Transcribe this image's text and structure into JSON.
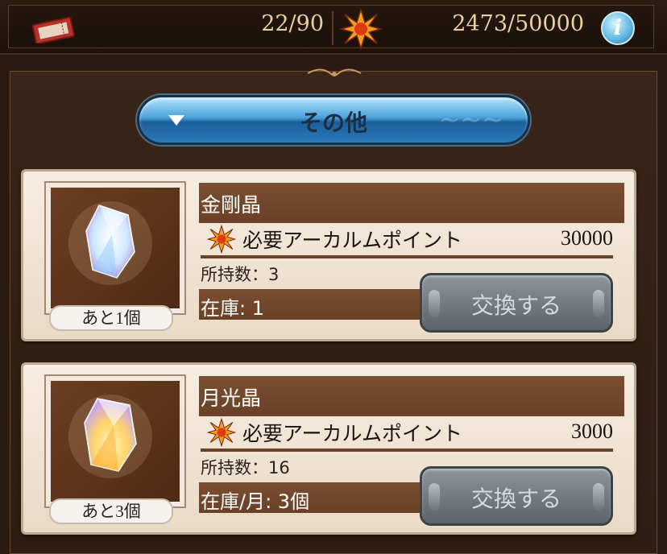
{
  "header": {
    "ticket_count": "22/90",
    "arcarum_points": "2473/50000",
    "info_symbol": "i"
  },
  "category": {
    "label": "その他"
  },
  "items": [
    {
      "name": "金剛晶",
      "points_label": "必要アーカルムポイント",
      "points_cost": "30000",
      "owned": "所持数：3",
      "stock": "在庫: 1",
      "remaining": "あと1個",
      "exchange_label": "交換する",
      "crystal_color": "#cfe8ff"
    },
    {
      "name": "月光晶",
      "points_label": "必要アーカルムポイント",
      "points_cost": "3000",
      "owned": "所持数：16",
      "stock": "在庫/月: 3個",
      "remaining": "あと3個",
      "exchange_label": "交換する",
      "crystal_color": "#ffd36a"
    }
  ],
  "colors": {
    "accent_blue": "#4aa0d8",
    "card_bg": "#f7ede0",
    "header_row": "#6a4128"
  }
}
